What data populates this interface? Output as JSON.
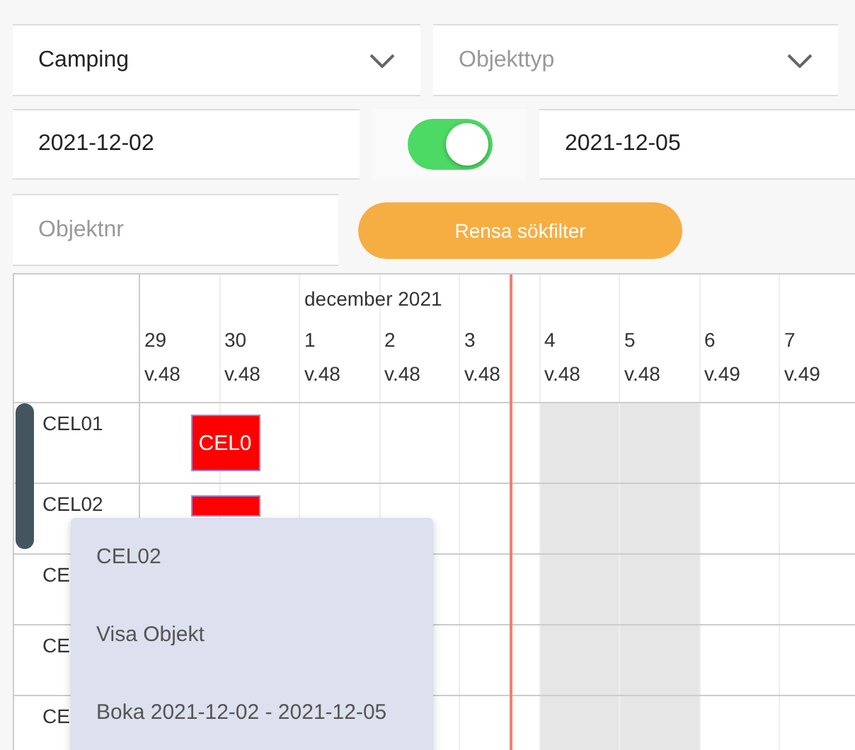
{
  "filters": {
    "campground": {
      "value": "Camping"
    },
    "object_type": {
      "placeholder": "Objekttyp"
    },
    "date_from": {
      "value": "2021-12-02"
    },
    "range_toggle": {
      "on": true
    },
    "date_to": {
      "value": "2021-12-05"
    },
    "object_number": {
      "placeholder": "Objektnr"
    },
    "clear_button": "Rensa sökfilter"
  },
  "calendar": {
    "rows": [
      {
        "label": "CEL01"
      },
      {
        "label": "CEL02"
      },
      {
        "label": "CE"
      },
      {
        "label": "CE"
      },
      {
        "label": "CE"
      }
    ],
    "days": [
      {
        "day": "29",
        "week": "v.48",
        "weekend": false,
        "now": false
      },
      {
        "day": "30",
        "week": "v.48",
        "weekend": false,
        "now": false,
        "bookings": [
          {
            "kind": "booking",
            "text": "CEL0"
          },
          {
            "kind": "booking"
          }
        ]
      },
      {
        "day": "1",
        "week": "v.48",
        "weekend": false,
        "now": false,
        "month": "december 2021"
      },
      {
        "day": "2",
        "week": "v.48",
        "weekend": false,
        "now": false
      },
      {
        "day": "3",
        "week": "v.48",
        "weekend": false,
        "now": true
      },
      {
        "day": "4",
        "week": "v.48",
        "weekend": true,
        "now": false
      },
      {
        "day": "5",
        "week": "v.48",
        "weekend": true,
        "now": false
      },
      {
        "day": "6",
        "week": "v.49",
        "weekend": false,
        "now": false
      },
      {
        "day": "7",
        "week": "v.49",
        "weekend": false,
        "now": false
      }
    ]
  },
  "context_menu": {
    "title": "CEL02",
    "items": [
      "Visa Objekt",
      "Boka 2021-12-02 - 2021-12-05"
    ]
  }
}
